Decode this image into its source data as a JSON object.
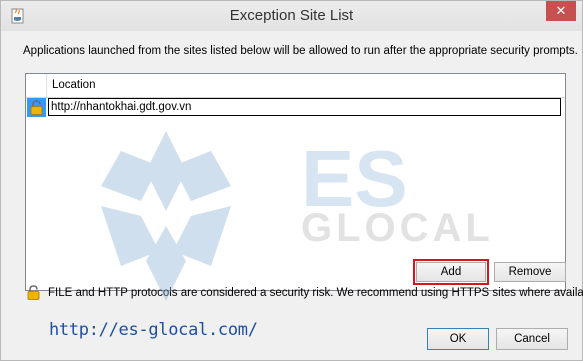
{
  "window": {
    "title": "Exception Site List",
    "close_glyph": "✕"
  },
  "description": "Applications launched from the sites listed below will be allowed to run after the appropriate security prompts.",
  "table": {
    "column_header": "Location",
    "rows": [
      {
        "icon": "lock-icon",
        "value": "http://nhantokhai.gdt.gov.vn"
      }
    ]
  },
  "buttons": {
    "add": "Add",
    "remove": "Remove",
    "ok": "OK",
    "cancel": "Cancel"
  },
  "warning": {
    "icon": "lock-icon",
    "text": "FILE and HTTP protocols are considered a security risk.  We recommend using HTTPS sites where available."
  },
  "watermark": {
    "line1": "ES",
    "line2": "GLOCAL"
  },
  "footer_link": "http://es-glocal.com/",
  "colors": {
    "selection": "#3399ff",
    "highlight_border": "#d9141b",
    "link": "#1f4fa0",
    "close": "#c75050"
  }
}
